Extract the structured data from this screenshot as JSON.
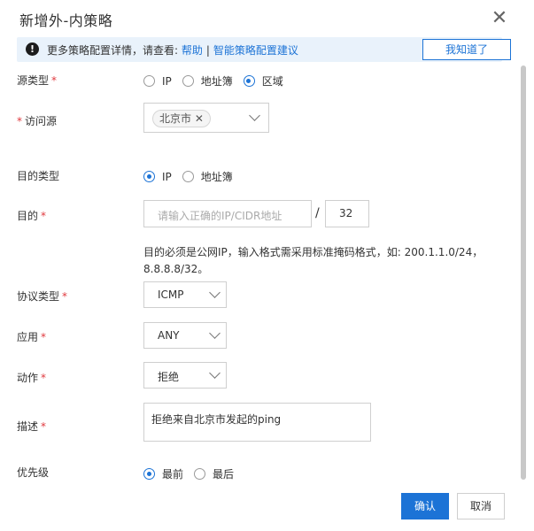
{
  "dialog": {
    "title": "新增外-内策略",
    "close_glyph": "✕"
  },
  "notice": {
    "icon": "!",
    "text": "更多策略配置详情，请查看: ",
    "help_link": "帮助",
    "separator": "|",
    "advice_link": "智能策略配置建议",
    "ack_button": "我知道了"
  },
  "form": {
    "source_type": {
      "label": "源类型",
      "required_mark": "*",
      "options": [
        "IP",
        "地址簿",
        "区域"
      ],
      "selected": "区域"
    },
    "access_source": {
      "label": "访问源",
      "required_mark": "*",
      "tag": "北京市 ✕"
    },
    "dest_type": {
      "label": "目的类型",
      "options": [
        "IP",
        "地址簿"
      ],
      "selected": "IP"
    },
    "dest": {
      "label": "目的",
      "required_mark": "*",
      "placeholder": "请输入正确的IP/CIDR地址",
      "slash": "/",
      "mask": "32",
      "hint": "目的必须是公网IP，输入格式需采用标准掩码格式，如: 200.1.1.0/24，8.8.8.8/32。"
    },
    "protocol": {
      "label": "协议类型",
      "required_mark": "*",
      "value": "ICMP"
    },
    "application": {
      "label": "应用",
      "required_mark": "*",
      "value": "ANY"
    },
    "action": {
      "label": "动作",
      "required_mark": "*",
      "value": "拒绝"
    },
    "description": {
      "label": "描述",
      "required_mark": "*",
      "value": "拒绝来自北京市发起的ping"
    },
    "priority": {
      "label": "优先级",
      "options": [
        "最前",
        "最后"
      ],
      "selected": "最前"
    }
  },
  "footer": {
    "confirm": "确认",
    "cancel": "取消"
  },
  "colors": {
    "accent": "#1c73d6",
    "required": "#e0393e",
    "notice_bg": "#e9f2fb"
  }
}
